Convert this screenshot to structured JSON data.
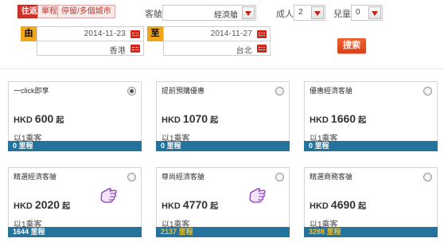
{
  "trip_tabs": [
    {
      "label": "往返",
      "active": true
    },
    {
      "label": "單程",
      "active": false
    },
    {
      "label": "停留/多個城市",
      "active": false
    }
  ],
  "cabin": {
    "label": "客艙",
    "value": "經濟艙"
  },
  "adults": {
    "label": "成人",
    "value": "2"
  },
  "children": {
    "label": "兒童",
    "value": "0"
  },
  "departure": {
    "tag": "由",
    "date": "2014-11-23",
    "city": "香港"
  },
  "arrival": {
    "tag": "至",
    "date": "2014-11-27",
    "city": "台北"
  },
  "search_label": "搜索",
  "colors": {
    "accent": "#d3322a",
    "bar": "#23739c",
    "tag": "#f0a61c",
    "miles_gold": "#f3c12f"
  },
  "cards": [
    {
      "title": "一click即享",
      "currency": "HKD",
      "amount": "600",
      "suffix": "起",
      "pax": "以1乘客",
      "miles": "0 里程",
      "selected": true,
      "gold": false
    },
    {
      "title": "提前預購優惠",
      "currency": "HKD",
      "amount": "1070",
      "suffix": "起",
      "pax": "以1乘客",
      "miles": "0 里程",
      "selected": false,
      "gold": false
    },
    {
      "title": "優惠經濟客艙",
      "currency": "HKD",
      "amount": "1660",
      "suffix": "起",
      "pax": "以1乘客",
      "miles": "0 里程",
      "selected": false,
      "gold": false
    },
    {
      "title": "精選經濟客艙",
      "currency": "HKD",
      "amount": "2020",
      "suffix": "起",
      "pax": "以1乘客",
      "miles": "1644 里程",
      "selected": false,
      "gold": false
    },
    {
      "title": "尊尚經濟客艙",
      "currency": "HKD",
      "amount": "4770",
      "suffix": "起",
      "pax": "以1乘客",
      "miles": "2137 里程",
      "selected": false,
      "gold": true
    },
    {
      "title": "精選商務客艙",
      "currency": "HKD",
      "amount": "4690",
      "suffix": "起",
      "pax": "以1乘客",
      "miles": "3288 里程",
      "selected": false,
      "gold": true
    }
  ]
}
